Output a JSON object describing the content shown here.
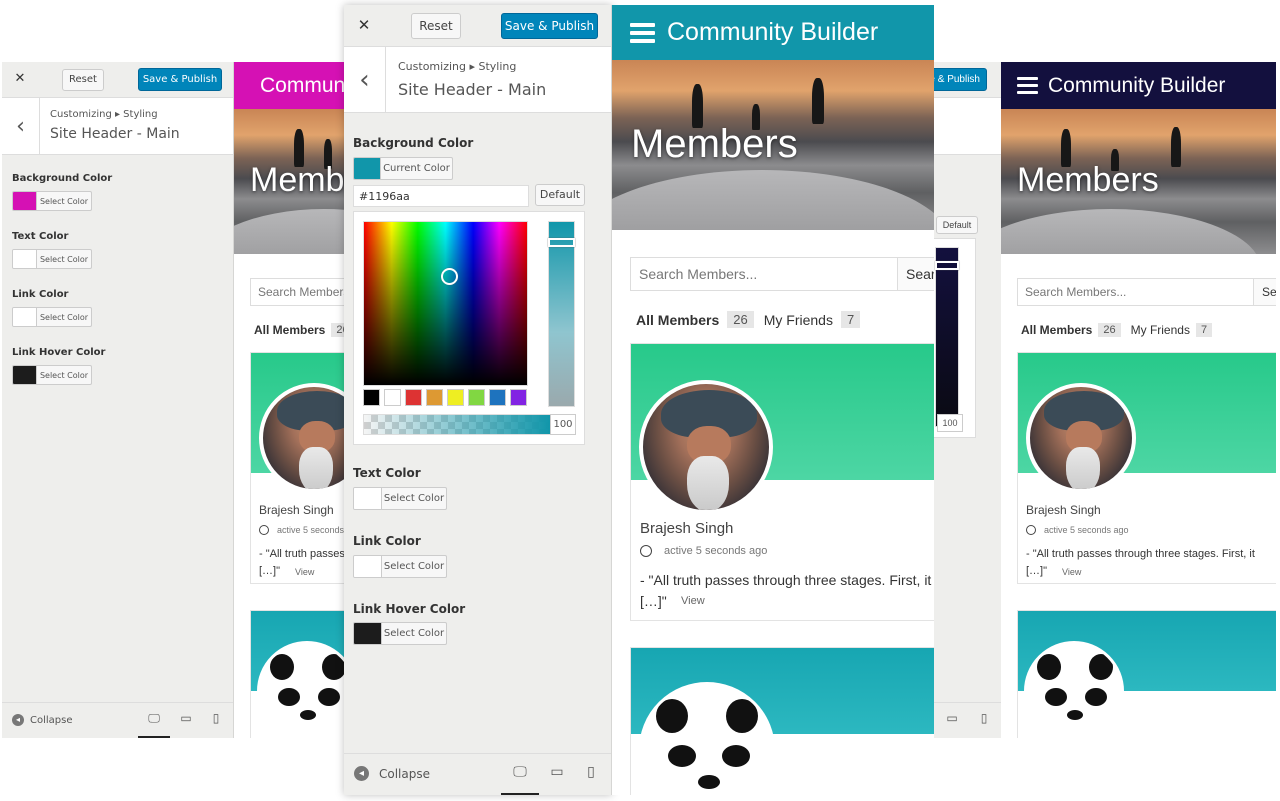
{
  "customizer": {
    "close_glyph": "✕",
    "reset_label": "Reset",
    "publish_label": "Save & Publish",
    "breadcrumb": "Customizing ▸ Styling",
    "section_title": "Site Header - Main",
    "back_glyph": "‹",
    "current_color_label": "Current Color",
    "select_color_label": "Select Color",
    "default_label": "Default",
    "hex_value": "#1196aa",
    "alpha_value": "100",
    "collapse_label": "Collapse",
    "collapse_glyph": "◂",
    "devices": [
      "desktop-icon",
      "tablet-icon",
      "mobile-icon"
    ],
    "device_glyphs": [
      "🖵",
      "▭",
      "▯"
    ],
    "fields": [
      {
        "label": "Background Color"
      },
      {
        "label": "Text Color"
      },
      {
        "label": "Link Color"
      },
      {
        "label": "Link Hover Color"
      }
    ]
  },
  "preview": {
    "site_title": "Community Builder",
    "page_title": "Members",
    "search_placeholder": "Search Members...",
    "search_button": "Search",
    "tab_all": "All Members",
    "tab_all_count": "26",
    "tab_friends": "My Friends",
    "tab_friends_count": "7",
    "member_name": "Brajesh Singh",
    "member_active": "active 5 seconds ago",
    "member_quote": "- \"All truth passes through three stages. First, it",
    "member_quote_end": "[…]\"",
    "view_label": "View"
  },
  "colors": {
    "magenta": "#d511b4",
    "teal": "#1196aa",
    "navy": "#13103e",
    "white": "#ffffff",
    "black": "#1c1c1c",
    "green_cover": "#27c98a",
    "teal_cover": "#17a6b2",
    "publish_blue": "#0085ba"
  },
  "palette": [
    "#000000",
    "#ffffff",
    "#dd3333",
    "#dd9933",
    "#eeee22",
    "#81d742",
    "#1e73be",
    "#8224e3"
  ]
}
